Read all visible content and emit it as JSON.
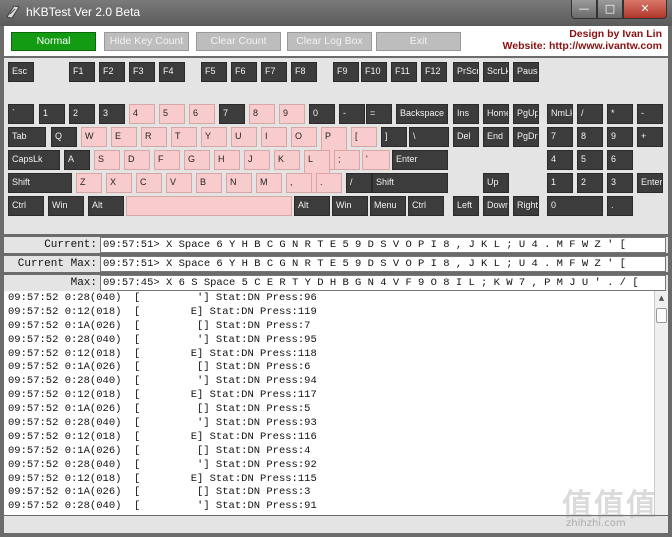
{
  "window": {
    "title": "hKBTest Ver 2.0 Beta",
    "minimize_glyph": "—",
    "maximize_glyph": "□",
    "close_glyph": "✕"
  },
  "toolbar": {
    "buttons": [
      {
        "label": "Normal",
        "active": true
      },
      {
        "label": "Hide Key Count",
        "active": false
      },
      {
        "label": "Clear Count",
        "active": false
      },
      {
        "label": "Clear Log Box",
        "active": false
      },
      {
        "label": "Exit",
        "active": false
      }
    ],
    "credit_line1": "Design by Ivan Lin",
    "credit_line2": "Website: http://www.ivantw.com"
  },
  "keyboard": {
    "highlight_color": "#f8cccc",
    "key_color": "#3c3c3c",
    "keys": [
      {
        "label": "Esc",
        "hl": false
      },
      {
        "label": "F1",
        "hl": false
      },
      {
        "label": "F2",
        "hl": false
      },
      {
        "label": "F3",
        "hl": false
      },
      {
        "label": "F4",
        "hl": false
      },
      {
        "label": "F5",
        "hl": false
      },
      {
        "label": "F6",
        "hl": false
      },
      {
        "label": "F7",
        "hl": false
      },
      {
        "label": "F8",
        "hl": false
      },
      {
        "label": "F9",
        "hl": false
      },
      {
        "label": "F10",
        "hl": false
      },
      {
        "label": "F11",
        "hl": false
      },
      {
        "label": "F12",
        "hl": false
      },
      {
        "label": "PrScr",
        "hl": false
      },
      {
        "label": "ScrLk",
        "hl": false
      },
      {
        "label": "Pause",
        "hl": false
      },
      {
        "label": "`",
        "hl": false
      },
      {
        "label": "1",
        "hl": false
      },
      {
        "label": "2",
        "hl": false
      },
      {
        "label": "3",
        "hl": false
      },
      {
        "label": "4",
        "hl": true
      },
      {
        "label": "5",
        "hl": true
      },
      {
        "label": "6",
        "hl": true
      },
      {
        "label": "7",
        "hl": false
      },
      {
        "label": "8",
        "hl": true
      },
      {
        "label": "9",
        "hl": true
      },
      {
        "label": "0",
        "hl": false
      },
      {
        "label": "-",
        "hl": false
      },
      {
        "label": "=",
        "hl": false
      },
      {
        "label": "Backspace",
        "hl": false
      },
      {
        "label": "Ins",
        "hl": false
      },
      {
        "label": "Home",
        "hl": false
      },
      {
        "label": "PgUp",
        "hl": false
      },
      {
        "label": "NmLk",
        "hl": false
      },
      {
        "label": "/",
        "hl": false
      },
      {
        "label": "*",
        "hl": false
      },
      {
        "label": "-",
        "hl": false
      },
      {
        "label": "Tab",
        "hl": false
      },
      {
        "label": "Q",
        "hl": false
      },
      {
        "label": "W",
        "hl": true
      },
      {
        "label": "E",
        "hl": true
      },
      {
        "label": "R",
        "hl": true
      },
      {
        "label": "T",
        "hl": true
      },
      {
        "label": "Y",
        "hl": true
      },
      {
        "label": "U",
        "hl": true
      },
      {
        "label": "I",
        "hl": true
      },
      {
        "label": "O",
        "hl": true
      },
      {
        "label": "P",
        "hl": true
      },
      {
        "label": "[",
        "hl": true
      },
      {
        "label": "]",
        "hl": false
      },
      {
        "label": "\\",
        "hl": false
      },
      {
        "label": "Del",
        "hl": false
      },
      {
        "label": "End",
        "hl": false
      },
      {
        "label": "PgDn",
        "hl": false
      },
      {
        "label": "7",
        "hl": false
      },
      {
        "label": "8",
        "hl": false
      },
      {
        "label": "9",
        "hl": false
      },
      {
        "label": "+",
        "hl": false
      },
      {
        "label": "CapsLk",
        "hl": false
      },
      {
        "label": "A",
        "hl": false
      },
      {
        "label": "S",
        "hl": true
      },
      {
        "label": "D",
        "hl": true
      },
      {
        "label": "F",
        "hl": true
      },
      {
        "label": "G",
        "hl": true
      },
      {
        "label": "H",
        "hl": true
      },
      {
        "label": "J",
        "hl": true
      },
      {
        "label": "K",
        "hl": true
      },
      {
        "label": "L",
        "hl": true
      },
      {
        "label": ";",
        "hl": true
      },
      {
        "label": "'",
        "hl": true
      },
      {
        "label": "Enter",
        "hl": false
      },
      {
        "label": "4",
        "hl": false
      },
      {
        "label": "5",
        "hl": false
      },
      {
        "label": "6",
        "hl": false
      },
      {
        "label": "Shift",
        "hl": false
      },
      {
        "label": "Z",
        "hl": true
      },
      {
        "label": "X",
        "hl": true
      },
      {
        "label": "C",
        "hl": true
      },
      {
        "label": "V",
        "hl": true
      },
      {
        "label": "B",
        "hl": true
      },
      {
        "label": "N",
        "hl": true
      },
      {
        "label": "M",
        "hl": true
      },
      {
        "label": ",",
        "hl": true
      },
      {
        "label": ".",
        "hl": true
      },
      {
        "label": "/",
        "hl": false
      },
      {
        "label": "Shift",
        "hl": false
      },
      {
        "label": "Up",
        "hl": false
      },
      {
        "label": "1",
        "hl": false
      },
      {
        "label": "2",
        "hl": false
      },
      {
        "label": "3",
        "hl": false
      },
      {
        "label": "Enter",
        "hl": false
      },
      {
        "label": "Ctrl",
        "hl": false
      },
      {
        "label": "Win",
        "hl": false
      },
      {
        "label": "Alt",
        "hl": false
      },
      {
        "label": "",
        "hl": true
      },
      {
        "label": "Alt",
        "hl": false
      },
      {
        "label": "Win",
        "hl": false
      },
      {
        "label": "Menu",
        "hl": false
      },
      {
        "label": "Ctrl",
        "hl": false
      },
      {
        "label": "Left",
        "hl": false
      },
      {
        "label": "Down",
        "hl": false
      },
      {
        "label": "Right",
        "hl": false
      },
      {
        "label": "0",
        "hl": false
      },
      {
        "label": ".",
        "hl": false
      }
    ]
  },
  "info": {
    "current_label": "Current:",
    "current_value": "09:57:51> X Space 6 Y H B C G N R T E 5 9 D S V O P I 8 , J K L ; U 4 . M F W Z ' [",
    "max_label": "Current Max:",
    "max_value": "09:57:51> X Space 6 Y H B C G N R T E 5 9 D S V O P I 8 , J K L ; U 4 . M F W Z ' [",
    "all_label": "Max:",
    "all_value": "09:57:45> X 6 S Space 5 C E R T Y D H B G N 4 V F 9 O 8 I L ; K W 7 , P M J U ' . / ["
  },
  "log": {
    "lines": [
      "09:57:52 0:28(040)  [         '] Stat:DN Press:96",
      "09:57:52 0:12(018)  [        E] Stat:DN Press:119",
      "09:57:52 0:1A(026)  [         [] Stat:DN Press:7",
      "09:57:52 0:28(040)  [         '] Stat:DN Press:95",
      "09:57:52 0:12(018)  [        E] Stat:DN Press:118",
      "09:57:52 0:1A(026)  [         [] Stat:DN Press:6",
      "09:57:52 0:28(040)  [         '] Stat:DN Press:94",
      "09:57:52 0:12(018)  [        E] Stat:DN Press:117",
      "09:57:52 0:1A(026)  [         [] Stat:DN Press:5",
      "09:57:52 0:28(040)  [         '] Stat:DN Press:93",
      "09:57:52 0:12(018)  [        E] Stat:DN Press:116",
      "09:57:52 0:1A(026)  [         [] Stat:DN Press:4",
      "09:57:52 0:28(040)  [         '] Stat:DN Press:92",
      "09:57:52 0:12(018)  [        E] Stat:DN Press:115",
      "09:57:52 0:1A(026)  [         [] Stat:DN Press:3",
      "09:57:52 0:28(040)  [         '] Stat:DN Press:91"
    ],
    "scroll_up_glyph": "▲"
  },
  "watermark": {
    "logo": "值值值",
    "site": "zhihzhi.com"
  }
}
